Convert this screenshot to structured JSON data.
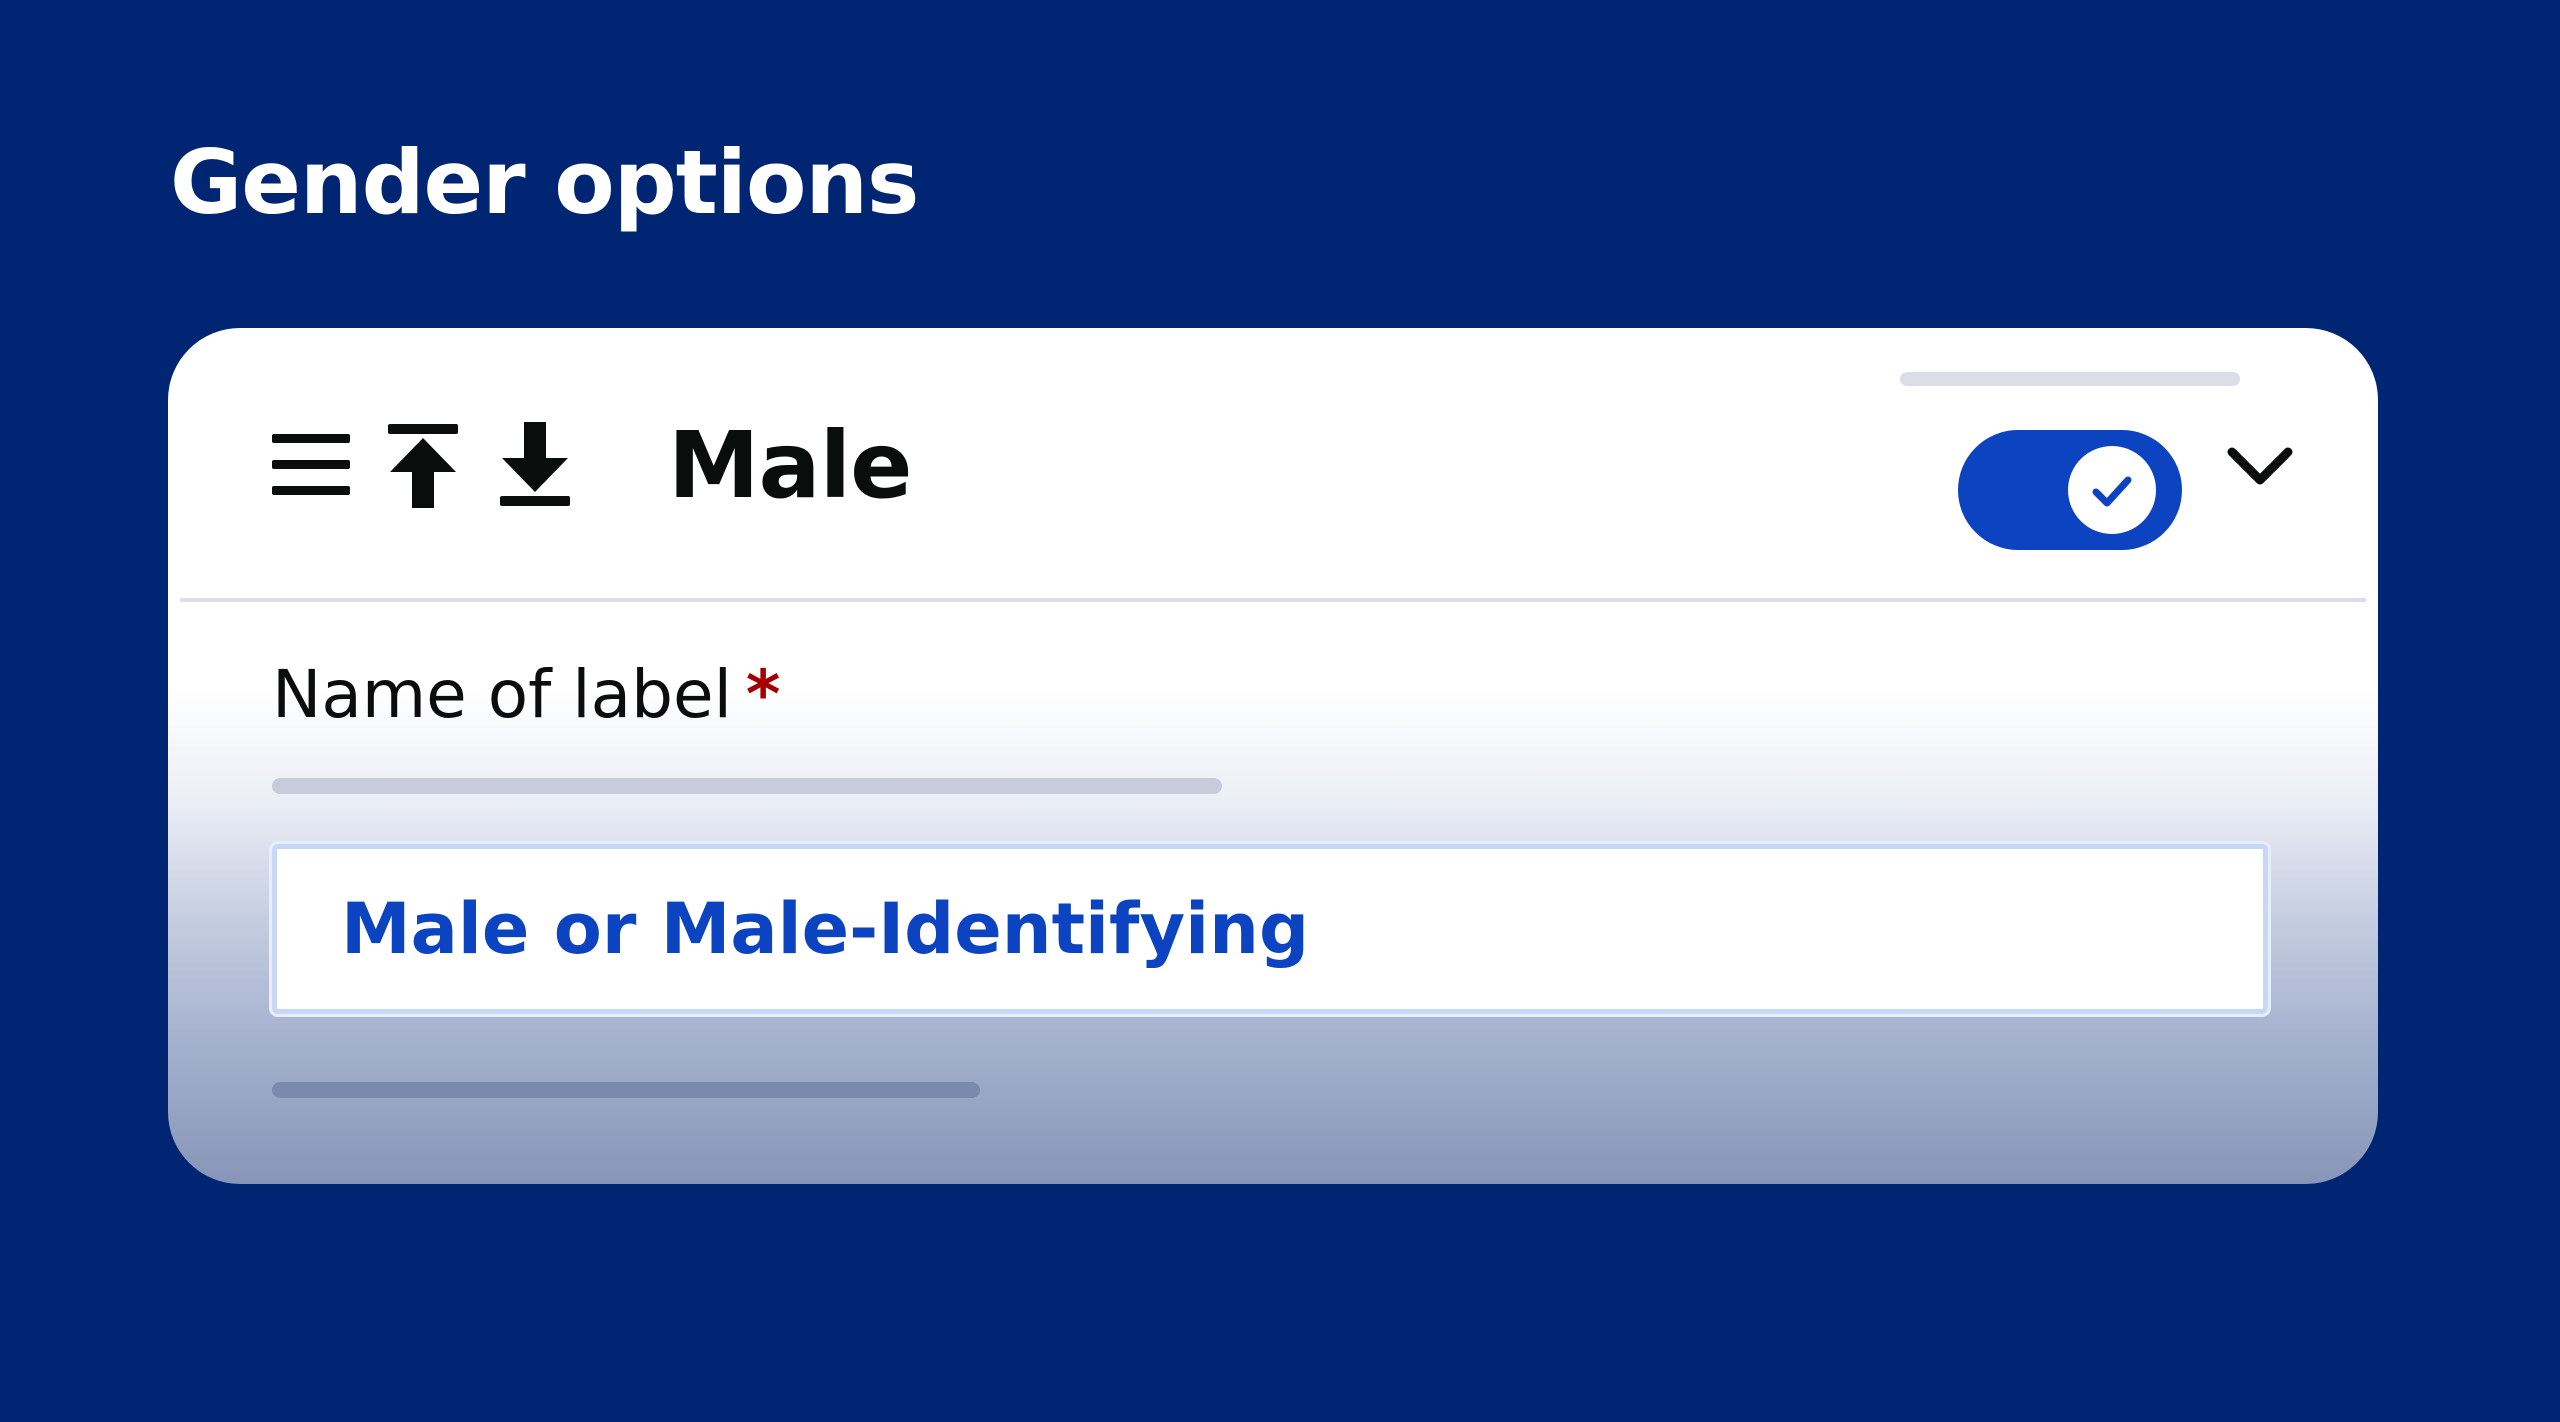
{
  "page": {
    "title": "Gender options"
  },
  "option": {
    "title": "Male",
    "enabled": true,
    "field_label": "Name of label",
    "required_marker": "*",
    "value": "Male or Male-Identifying"
  },
  "icons": {
    "menu": "hamburger-menu-icon",
    "move_top": "move-to-top-icon",
    "move_bottom": "move-to-bottom-icon",
    "toggle_check": "check-icon",
    "expand": "chevron-down-icon"
  },
  "colors": {
    "background": "#002673",
    "accent": "#0b43c0",
    "required": "#a40000",
    "text": "#0b0c0c"
  }
}
